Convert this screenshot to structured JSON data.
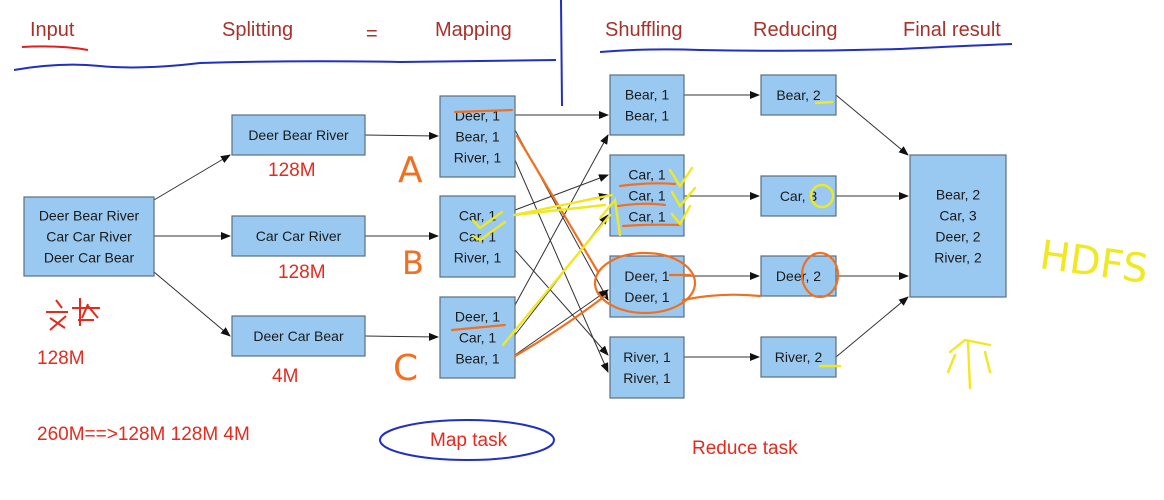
{
  "headers": {
    "input": "Input",
    "splitting": "Splitting",
    "equals": "=",
    "mapping": "Mapping",
    "shuffling": "Shuffling",
    "reducing": "Reducing",
    "final": "Final result"
  },
  "input_box": [
    "Deer Bear River",
    "Car Car River",
    "Deer Car Bear"
  ],
  "split_boxes": [
    [
      "Deer Bear River"
    ],
    [
      "Car Car River"
    ],
    [
      "Deer Car Bear"
    ]
  ],
  "map_boxes": [
    [
      "Deer, 1",
      "Bear, 1",
      "River, 1"
    ],
    [
      "Car, 1",
      "Car, 1",
      "River, 1"
    ],
    [
      "Deer, 1",
      "Car, 1",
      "Bear, 1"
    ]
  ],
  "shuffle_boxes": [
    [
      "Bear, 1",
      "Bear, 1"
    ],
    [
      "Car, 1",
      "Car, 1",
      "Car, 1"
    ],
    [
      "Deer, 1",
      "Deer, 1"
    ],
    [
      "River, 1",
      "River, 1"
    ]
  ],
  "reduce_boxes": [
    [
      "Bear, 2"
    ],
    [
      "Car, 3"
    ],
    [
      "Deer, 2"
    ],
    [
      "River, 2"
    ]
  ],
  "final_box": [
    "Bear, 2",
    "Car, 3",
    "Deer, 2",
    "River, 2"
  ],
  "annotations": {
    "split_size_1": "128M",
    "split_size_2": "128M",
    "split_size_3": "4M",
    "input_handwritten": "文本",
    "input_size": "128M",
    "split_note": "260M==>128M 128M 4M",
    "map_task": "Map task",
    "reduce_task": "Reduce task",
    "label_a": "A",
    "label_b": "B",
    "label_c": "C",
    "hdfs": "HDFS"
  },
  "colors": {
    "box": "#99c9f1",
    "header": "#a8322a",
    "note": "#e52a1e",
    "orange": "#f07020",
    "yellow": "#f0e820",
    "blue": "#2030c0"
  }
}
